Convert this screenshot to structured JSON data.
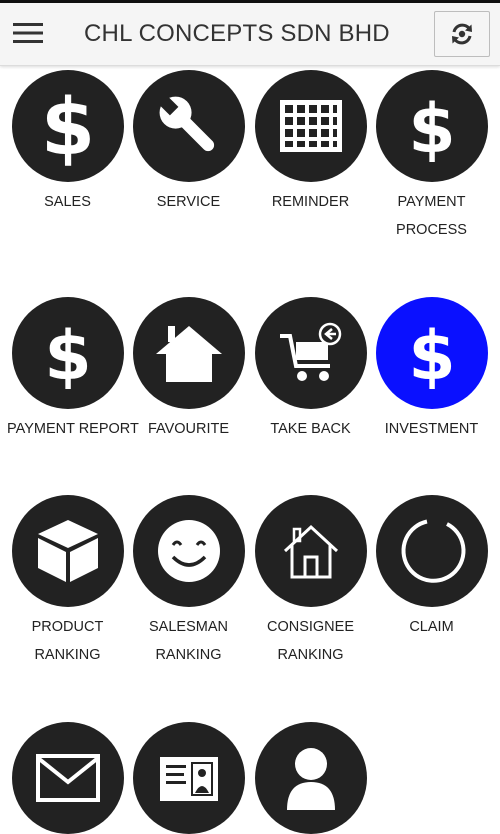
{
  "app": {
    "title": "CHL CONCEPTS SDN BHD"
  },
  "header": {
    "menu_icon": "hamburger-menu-icon",
    "refresh_icon": "refresh-icon"
  },
  "colors": {
    "tile_dark": "#222222",
    "tile_highlight": "#0a10ff",
    "header_bg": "#f5f5f5"
  },
  "tiles": [
    {
      "id": "sales",
      "icon": "dollar-icon",
      "lines": [
        "SALES"
      ]
    },
    {
      "id": "service",
      "icon": "wrench-icon",
      "lines": [
        "SERVICE"
      ]
    },
    {
      "id": "reminder",
      "icon": "calendar-grid-icon",
      "lines": [
        "REMINDER"
      ]
    },
    {
      "id": "payment-process",
      "icon": "dollar-icon",
      "lines": [
        "PAYMENT",
        "PROCESS"
      ]
    },
    {
      "id": "payment-report",
      "icon": "dollar-icon",
      "lines": [
        "PAYMENT REPORT"
      ]
    },
    {
      "id": "favourite",
      "icon": "house-icon",
      "lines": [
        "FAVOURITE"
      ]
    },
    {
      "id": "take-back",
      "icon": "cart-return-icon",
      "lines": [
        "TAKE BACK"
      ]
    },
    {
      "id": "investment",
      "icon": "dollar-icon",
      "lines": [
        "INVESTMENT"
      ]
    },
    {
      "id": "product-ranking",
      "icon": "box-icon",
      "lines": [
        "PRODUCT",
        "RANKING"
      ]
    },
    {
      "id": "salesman-ranking",
      "icon": "smiley-icon",
      "lines": [
        "SALESMAN",
        "RANKING"
      ]
    },
    {
      "id": "consignee-ranking",
      "icon": "house-outline-icon",
      "lines": [
        "CONSIGNEE",
        "RANKING"
      ]
    },
    {
      "id": "claim",
      "icon": "ring-icon",
      "lines": [
        "CLAIM"
      ]
    },
    {
      "id": "mail",
      "icon": "envelope-icon",
      "lines": []
    },
    {
      "id": "id-card",
      "icon": "id-card-icon",
      "lines": []
    },
    {
      "id": "profile",
      "icon": "person-icon",
      "lines": []
    }
  ]
}
